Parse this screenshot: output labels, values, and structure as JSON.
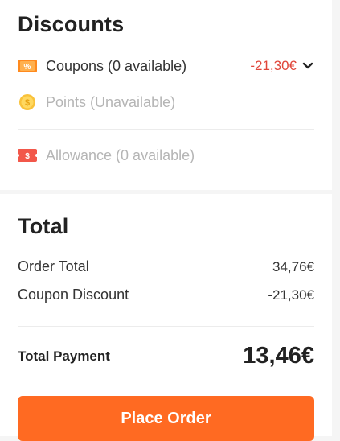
{
  "discounts": {
    "title": "Discounts",
    "coupons": {
      "label": "Coupons (0 available)",
      "value": "-21,30€",
      "icon": "coupon-icon",
      "accent": "#e0463a"
    },
    "points": {
      "label": "Points (Unavailable)",
      "icon": "coin-icon"
    },
    "allowance": {
      "label": "Allowance (0 available)",
      "icon": "allowance-ticket-icon"
    }
  },
  "total": {
    "title": "Total",
    "order_total_label": "Order Total",
    "order_total_value": "34,76€",
    "coupon_discount_label": "Coupon Discount",
    "coupon_discount_value": "-21,30€",
    "total_payment_label": "Total Payment",
    "total_payment_value": "13,46€"
  },
  "actions": {
    "place_order_label": "Place Order",
    "button_color": "#ff6a22"
  }
}
